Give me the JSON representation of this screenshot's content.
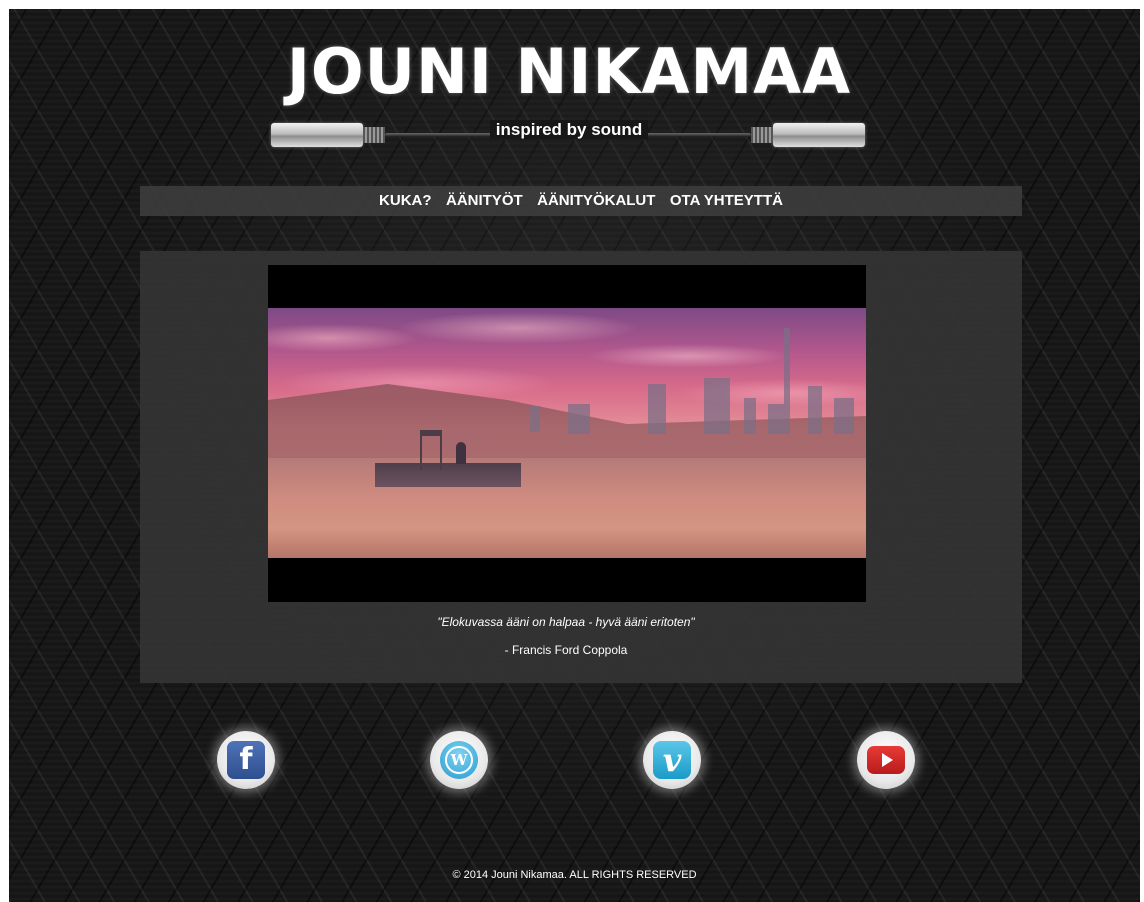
{
  "logo": {
    "title": "JOUNI NIKAMAA",
    "tagline": "inspired by sound"
  },
  "nav": {
    "items": [
      {
        "label": "KUKA?"
      },
      {
        "label": "ÄÄNITYÖT"
      },
      {
        "label": "ÄÄNITYÖKALUT"
      },
      {
        "label": "OTA YHTEYTTÄ"
      }
    ]
  },
  "content": {
    "quote": "\"Elokuvassa ääni on halpaa - hyvä ääni eritoten\"",
    "quote_author": "- Francis Ford Coppola"
  },
  "social": {
    "facebook_glyph": "f",
    "wordpress_glyph": "W",
    "vimeo_glyph": "v",
    "icons": [
      "facebook-icon",
      "wordpress-icon",
      "vimeo-icon",
      "youtube-icon"
    ]
  },
  "footer": {
    "copyright": "© 2014 Jouni Nikamaa. ALL RIGHTS RESERVED"
  },
  "colors": {
    "background": "#161616",
    "panel": "#343434",
    "nav_bar": "#3e3e3e",
    "text": "#ffffff",
    "facebook": "#3b5998",
    "wordpress": "#21759b",
    "vimeo": "#1ab7ea",
    "youtube": "#cc181e"
  }
}
